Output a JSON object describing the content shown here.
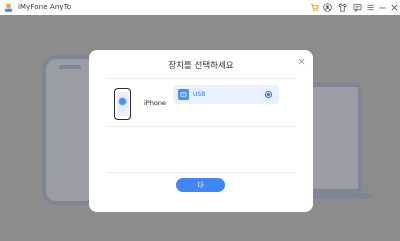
{
  "app": {
    "title": "iMyFone AnyTo"
  },
  "titlebar": {
    "icons": [
      "cart-icon",
      "user-icon",
      "shirt-icon",
      "message-icon",
      "menu-icon",
      "minimize-icon",
      "close-icon"
    ]
  },
  "modal": {
    "title": "장치를 선택하세요",
    "device_name": "iPhone",
    "connection_option": "USB",
    "confirm_label": "다",
    "close_icon": "close-icon"
  },
  "colors": {
    "accent": "#3f86f7",
    "option_bg": "#eaf1fe",
    "overlay": "#8c8c8c"
  }
}
